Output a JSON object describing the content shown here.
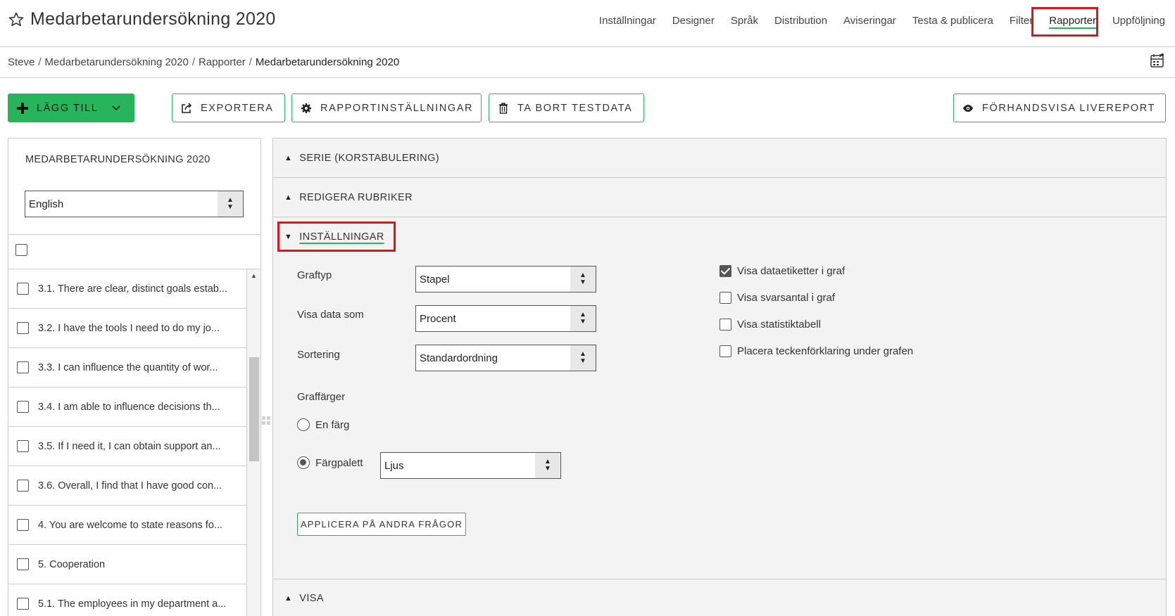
{
  "header": {
    "title": "Medarbetarundersökning 2020",
    "nav": [
      "Inställningar",
      "Designer",
      "Språk",
      "Distribution",
      "Aviseringar",
      "Testa & publicera",
      "Filter",
      "Rapporter",
      "Uppföljning"
    ],
    "active_nav": "Rapporter"
  },
  "breadcrumb": {
    "items": [
      "Steve",
      "Medarbetarundersökning 2020",
      "Rapporter"
    ],
    "current": "Medarbetarundersökning 2020"
  },
  "toolbar": {
    "add_label": "LÄGG TILL",
    "export_label": "EXPORTERA",
    "report_settings_label": "RAPPORTINSTÄLLNINGAR",
    "delete_test_label": "TA BORT TESTDATA",
    "preview_label": "FÖRHANDSVISA LIVEREPORT"
  },
  "left_panel": {
    "title": "MEDARBETARUNDERSÖKNING 2020",
    "language": "English",
    "questions": [
      "3.1.  There are clear, distinct goals estab...",
      "3.2.  I have the tools I need to do my jo...",
      "3.3.  I can influence the quantity of wor...",
      "3.4.  I am able to influence decisions th...",
      "3.5.  If I need it, I can obtain support an...",
      "3.6.  Overall, I find that I have good con...",
      "4.  You are welcome to state reasons fo...",
      "5.  Cooperation",
      "5.1.  The employees in my department a..."
    ]
  },
  "right_panel": {
    "sections": {
      "series": "SERIE (KORSTABULERING)",
      "headings": "REDIGERA RUBRIKER",
      "settings": "INSTÄLLNINGAR",
      "view": "VISA"
    },
    "settings": {
      "graph_type_label": "Graftyp",
      "graph_type_value": "Stapel",
      "show_data_label": "Visa data som",
      "show_data_value": "Procent",
      "sort_label": "Sortering",
      "sort_value": "Standardordning",
      "colors_label": "Graffärger",
      "one_color_label": "En färg",
      "palette_label": "Färgpalett",
      "palette_value": "Ljus",
      "apply_label": "APPLICERA PÅ ANDRA FRÅGOR",
      "checkboxes": [
        {
          "label": "Visa dataetiketter i graf",
          "checked": true
        },
        {
          "label": "Visa svarsantal i graf",
          "checked": false
        },
        {
          "label": "Visa statistiktabell",
          "checked": false
        },
        {
          "label": "Placera teckenförklaring under grafen",
          "checked": false
        }
      ]
    }
  },
  "colors": {
    "accent": "#27b55c",
    "highlight": "#e0121b"
  }
}
